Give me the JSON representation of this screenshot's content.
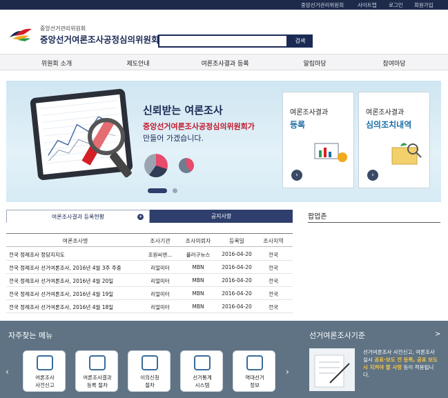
{
  "top_links": [
    "중앙선거관리위원회",
    "사이트맵",
    "로그인",
    "회원가입"
  ],
  "header": {
    "org_small": "중앙선거관리위원회",
    "org_big": "중앙선거여론조사공정심의위원회",
    "search_placeholder": "",
    "search_button": "검색"
  },
  "nav": [
    "위원회 소개",
    "제도안내",
    "여론조사결과 등록",
    "알림마당",
    "참여마당"
  ],
  "banner": {
    "title": "신뢰받는 여론조사",
    "sub_highlight": "중앙선거여론조사공정심의위원회가",
    "sub_rest": "만들어 가겠습니다.",
    "cards": [
      {
        "line1": "여론조사결과",
        "line2": "등록"
      },
      {
        "line1": "여론조사결과",
        "line2": "심의조치내역"
      }
    ]
  },
  "tabs": {
    "active": "여론조사결과 등록현황",
    "inactive": "공지사항",
    "more": "+"
  },
  "table": {
    "headers": [
      "여론조사명",
      "조사기관",
      "조사의뢰자",
      "등록일",
      "조사지역"
    ],
    "rows": [
      [
        "전국 정례조사 정당지지도",
        "조원씨앤...",
        "플러구뉴스",
        "2016-04-20",
        "전국"
      ],
      [
        "전국 정례조사 선거여론조사, 2016년 4월 3주 주중",
        "리얼미터",
        "MBN",
        "2016-04-20",
        "전국"
      ],
      [
        "전국 정례조사 선거여론조사, 2016년 4월 20일",
        "리얼미터",
        "MBN",
        "2016-04-20",
        "전국"
      ],
      [
        "전국 정례조사 선거여론조사, 2016년 4월 19일",
        "리얼미터",
        "MBN",
        "2016-04-20",
        "전국"
      ],
      [
        "전국 정례조사 선거여론조사, 2016년 4월 18일",
        "리얼미터",
        "MBN",
        "2016-04-20",
        "전국"
      ]
    ]
  },
  "applinks_title": "팝업존",
  "faq": {
    "title": "자주찾는 메뉴",
    "tiles": [
      {
        "l1": "여론조사",
        "l2": "사전신고"
      },
      {
        "l1": "여론조사결과",
        "l2": "등록 절차"
      },
      {
        "l1": "이의신청",
        "l2": "절차"
      },
      {
        "l1": "선거통계",
        "l2": "시스템"
      },
      {
        "l1": "역대선거",
        "l2": "정보"
      }
    ]
  },
  "standard": {
    "title": "선거여론조사기준",
    "more": ">",
    "text_a": "선거여론조사 사전신고,",
    "text_b": "여론조사 실시",
    "text_hl1": "공표·보도 전",
    "text_hl2": "등록, 공표 보도 시 지켜야 할 사항",
    "text_c": "등이 적용됩니다."
  }
}
